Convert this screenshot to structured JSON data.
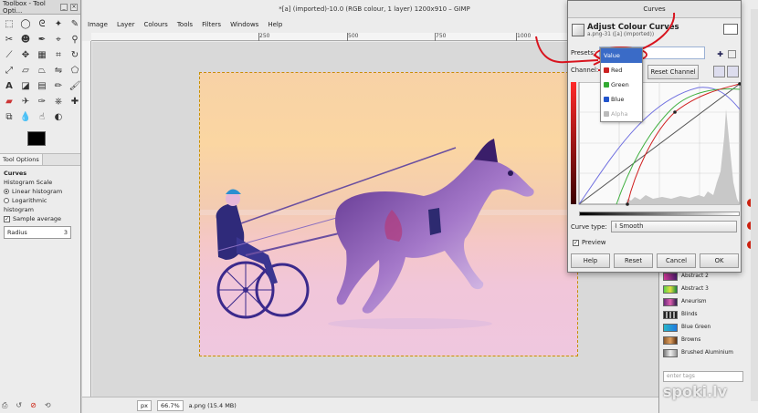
{
  "toolbox": {
    "title": "Toolbox - Tool Opti...",
    "tabs": [
      "Tool Options"
    ],
    "options": {
      "heading": "Curves",
      "histogram_scale_label": "Histogram Scale",
      "linear_label": "Linear histogram",
      "log_label": "Logarithmic histogram",
      "sample_average_label": "Sample average",
      "radius_label": "Radius",
      "radius_value": "3"
    }
  },
  "image_window": {
    "title": "*[a] (imported)-10.0 (RGB colour, 1 layer) 1200x910 – GIMP",
    "menu": [
      "Image",
      "Layer",
      "Colours",
      "Tools",
      "Filters",
      "Windows",
      "Help"
    ],
    "ruler_ticks": [
      "250",
      "500",
      "750",
      "1000"
    ],
    "status": {
      "unit": "px",
      "zoom": "66.7%",
      "file": "a.png (15.4 MB)"
    }
  },
  "curves": {
    "title": "Curves",
    "heading": "Adjust Colour Curves",
    "subheading": "a.png-31 ([a] (imported))",
    "presets_label": "Presets:",
    "channel_label": "Channel:",
    "reset_channel": "Reset Channel",
    "channel_options": [
      {
        "label": "Value",
        "selected": true,
        "disabled": false,
        "color": ""
      },
      {
        "label": "Red",
        "selected": false,
        "disabled": false,
        "color": "#cc2222"
      },
      {
        "label": "Green",
        "selected": false,
        "disabled": false,
        "color": "#33aa33"
      },
      {
        "label": "Blue",
        "selected": false,
        "disabled": false,
        "color": "#2255cc"
      },
      {
        "label": "Alpha",
        "selected": false,
        "disabled": true,
        "color": "#999999"
      }
    ],
    "curve_type_label": "Curve type:",
    "curve_type_value": "Smooth",
    "preview_label": "Preview",
    "buttons": {
      "help": "Help",
      "reset": "Reset",
      "cancel": "Cancel",
      "ok": "OK"
    }
  },
  "gradients": {
    "items": [
      {
        "name": "Abstract 2",
        "color": "#d43a9a"
      },
      {
        "name": "Abstract 3",
        "color": "#5ad04a"
      },
      {
        "name": "Aneurism",
        "color": "#6a2a7a"
      },
      {
        "name": "Blinds",
        "color": "#888888"
      },
      {
        "name": "Blue Green",
        "color": "#29b6c8"
      },
      {
        "name": "Browns",
        "color": "#8b5a2b"
      },
      {
        "name": "Brushed Aluminium",
        "color": "#b7b7b7"
      }
    ],
    "tags_placeholder": "enter tags"
  },
  "watermark": "spoki.lv"
}
